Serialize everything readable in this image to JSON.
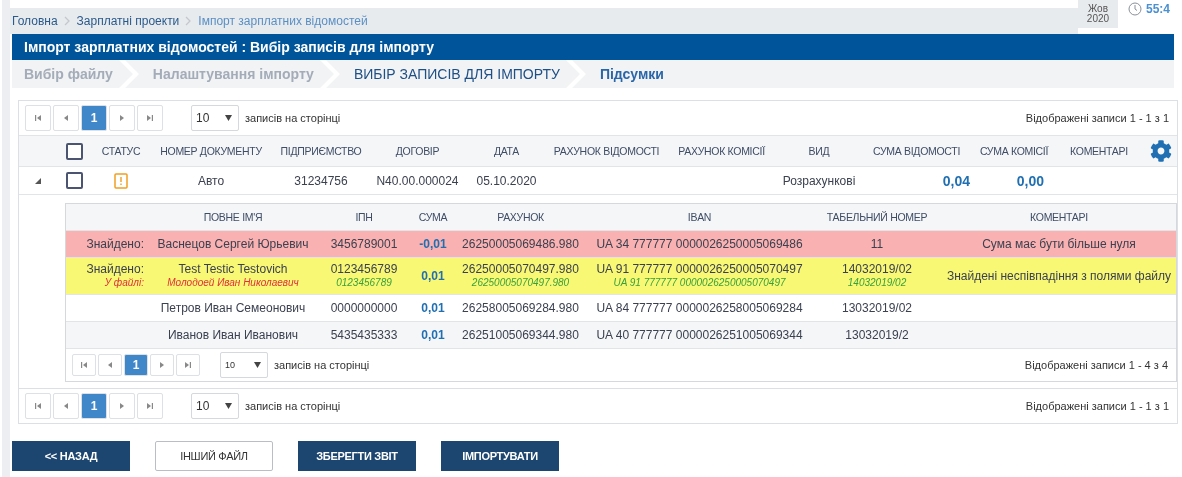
{
  "breadcrumbs": [
    {
      "label": "Головна",
      "current": false
    },
    {
      "label": "Зарплатні проекти",
      "current": false
    },
    {
      "label": "Імпорт зарплатних відомостей",
      "current": true
    }
  ],
  "date": {
    "month": "Жов",
    "year": "2020"
  },
  "timer": "55:4",
  "title": "Імпорт зарплатних відомостей : Вибір записів для імпорту",
  "steps": [
    {
      "label": "Вибір файлу",
      "completed": true,
      "selected": false
    },
    {
      "label": "Налаштування імпорту",
      "completed": true,
      "selected": false
    },
    {
      "label": "ВИБІР ЗАПИСІВ ДЛЯ ІМПОРТУ",
      "completed": false,
      "selected": true
    },
    {
      "label": "Підсумки",
      "completed": false,
      "selected": false
    }
  ],
  "table": {
    "pager_top": {
      "pages": [
        {
          "label": "1",
          "selected": true
        }
      ],
      "page_size": "10",
      "per_page_label": "записів на сторінці",
      "summary": "Відображені записи 1 - 1 з 1"
    },
    "header_checked": false,
    "columns": [
      "СТАТУС",
      "НОМЕР ДОКУМЕНТУ",
      "ПІДПРИЄМСТВО",
      "ДОГОВІР",
      "ДАТА",
      "РАХУНОК ВІДОМОСТІ",
      "РАХУНОК КОМІСІЇ",
      "ВИД",
      "СУМА ВІДОМОСТІ",
      "СУМА КОМІСІЇ",
      "КОМЕНТАРІ"
    ],
    "rows": [
      {
        "expanded": true,
        "checked": false,
        "warning": true,
        "doc_number": "Авто",
        "company": "31234756",
        "contract": "N40.00.000024",
        "date": "05.10.2020",
        "type": "Розрахункові",
        "sum": "0,04",
        "fee": "0,00",
        "details": {
          "columns": [
            "ПОВНЕ ІМ'Я",
            "ІПН",
            "СУМА",
            "РАХУНОК",
            "IBAN",
            "ТАБЕЛЬНИЙ НОМЕР",
            "КОМЕНТАРІ"
          ],
          "rows": [
            {
              "kind": "error",
              "found_label": "Знайдено:",
              "name": "Васнецов Сергей Юрьевич",
              "ipn": "3456789001",
              "sum": "-0,01",
              "account": "26250005069486.980",
              "iban": "UA 34 777777 0000026250005069486",
              "tab_number": "11",
              "comment": "Сума має бути більше нуля"
            },
            {
              "kind": "mismatch",
              "found_label": "Знайдено:",
              "file_label": "У файлі:",
              "name": "Test Testic Testovich",
              "file_name": "Молодоей Иван Николаевич",
              "ipn": "0123456789",
              "file_ipn": "0123456789",
              "sum": "0,01",
              "account": "26250005070497.980",
              "file_account": "26250005070497.980",
              "iban": "UA 91 777777 0000026250005070497",
              "file_iban": "UA 91 777777 0000026250005070497",
              "tab_number": "14032019/02",
              "file_tab_number": "14032019/02",
              "comment": "Знайдені неспівпадіння з полями файлу"
            },
            {
              "kind": "plain",
              "name": "Петров Иван Семеонович",
              "ipn": "0000000000",
              "sum": "0,01",
              "account": "26258005069284.980",
              "iban": "UA 84 777777 0000026258005069284",
              "tab_number": "13032019/02"
            },
            {
              "kind": "plain",
              "name": "Иванов Иван Иванович",
              "ipn": "5435435333",
              "sum": "0,01",
              "account": "26251005069344.980",
              "iban": "UA 40 777777 0000026251005069344",
              "tab_number": "13032019/2"
            }
          ],
          "pager": {
            "pages": [
              {
                "label": "1",
                "selected": true
              }
            ],
            "page_size": "10",
            "per_page_label": "записів на сторінці",
            "summary": "Відображені записи 1 - 4 з 4"
          }
        }
      }
    ],
    "pager_bottom": {
      "pages": [
        {
          "label": "1",
          "selected": true
        }
      ],
      "page_size": "10",
      "per_page_label": "записів на сторінці",
      "summary": "Відображені записи 1 - 1 з 1"
    }
  },
  "buttons": [
    {
      "label": "<< НАЗАД",
      "kind": "primary"
    },
    {
      "label": "ІНШИЙ ФАЙЛ",
      "kind": "secondary"
    },
    {
      "label": "ЗБЕРЕГТИ ЗВІТ",
      "kind": "primary"
    },
    {
      "label": "ІМПОРТУВАТИ",
      "kind": "primary"
    }
  ]
}
